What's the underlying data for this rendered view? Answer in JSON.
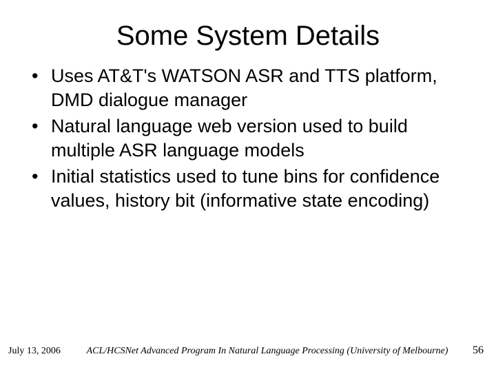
{
  "title": "Some System Details",
  "bullets": [
    "Uses AT&T's WATSON ASR and TTS platform, DMD dialogue manager",
    "Natural language web version used to build multiple ASR language models",
    "Initial statistics used to tune bins for confidence values, history bit (informative state encoding)"
  ],
  "footer": {
    "date": "July 13, 2006",
    "venue": "ACL/HCSNet Advanced Program In Natural Language Processing (University of Melbourne)",
    "pagenum": "56"
  }
}
